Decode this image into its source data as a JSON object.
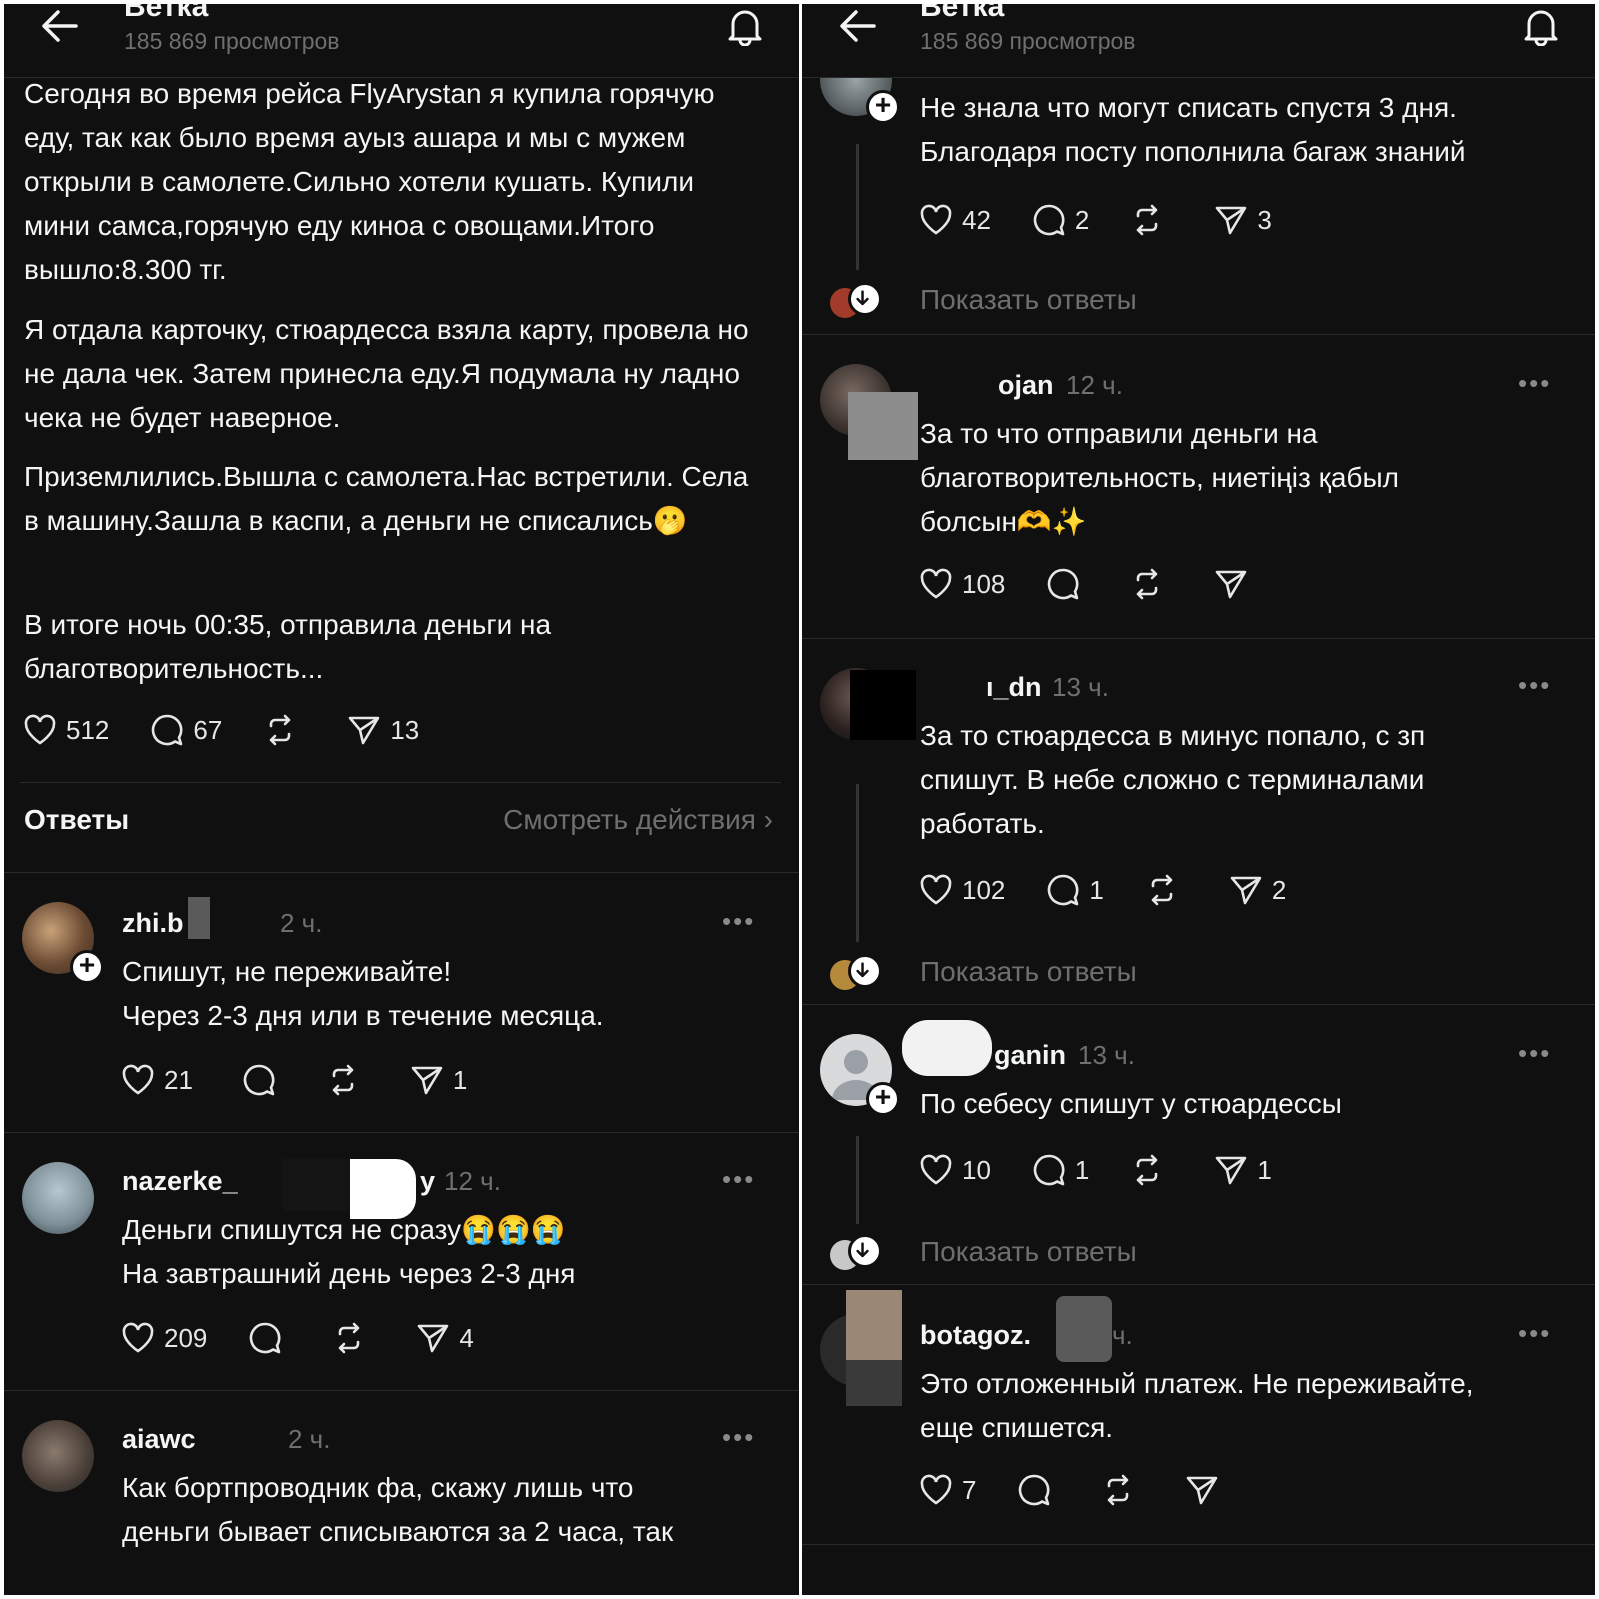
{
  "header": {
    "title": "Ветка",
    "views": "185 869 просмотров"
  },
  "post": {
    "paragraphs": [
      "Сегодня во время рейса FlyArystan я купила горячую еду, так как было время ауыз ашара и мы с мужем открыли в самолете.Сильно хотели кушать. Купили мини самса,горячую еду киноа с овощами.Итого вышло:8.300 тг.",
      "Я отдала карточку, стюардесса взяла карту, провела но не дала чек. Затем принесла еду.Я подумала ну ладно чека не будет наверное.",
      "Приземлились.Вышла с самолета.Нас встретили. Села в машину.Зашла в каспи, а деньги не списались🫢",
      "В итоге ночь 00:35, отправила деньги на благотворительность..."
    ],
    "likes": "512",
    "comments": "67",
    "shares": "13"
  },
  "replies_header": {
    "title": "Ответы",
    "link": "Смотреть действия ›"
  },
  "left_replies": [
    {
      "user": "zhi.b",
      "time": "2 ч.",
      "lines": [
        "Спишут, не переживайте!",
        "Через 2-3 дня или в течение месяца."
      ],
      "likes": "21",
      "comments": "",
      "shares": "1"
    },
    {
      "user": "nazerke_",
      "user_tail": "y",
      "time": "12 ч.",
      "lines": [
        "Деньги спишутся не сразу😭😭😭",
        "На завтрашний день через 2-3 дня"
      ],
      "likes": "209",
      "comments": "",
      "shares": "4"
    },
    {
      "user": "aiawc",
      "time": "2 ч.",
      "lines": [
        "Как бортпроводник фа, скажу лишь что",
        "деньги бывает списываются за 2 часа, так"
      ]
    }
  ],
  "right_top": {
    "lines": [
      "Не знала что могут списать спустя 3 дня.",
      "Благодаря посту пополнила багаж знаний"
    ],
    "likes": "42",
    "comments": "2",
    "shares": "3"
  },
  "show_replies_label": "Показать ответы",
  "right_replies": [
    {
      "user": "ojan",
      "time": "12 ч.",
      "lines": [
        "За то что отправили деньги на",
        "благотворительность, ниетіңіз қабыл",
        "болсын🫶✨"
      ],
      "likes": "108",
      "comments": "",
      "shares": ""
    },
    {
      "user": "ı_dn",
      "time": "13 ч.",
      "lines": [
        "За то стюардесса в минус попало, с зп",
        "спишут. В небе сложно с терминалами",
        "работать."
      ],
      "likes": "102",
      "comments": "1",
      "shares": "2"
    },
    {
      "user": "ganin",
      "time": "13 ч.",
      "lines": [
        "По себесу спишут  у стюардессы"
      ],
      "likes": "10",
      "comments": "1",
      "shares": "1"
    },
    {
      "user": "botagoz.",
      "time": "ч.",
      "lines": [
        "Это отложенный платеж. Не переживайте,",
        "еще спишется."
      ],
      "likes": "7",
      "comments": "",
      "shares": ""
    }
  ],
  "more_label": "•••",
  "colors": {
    "background": "#101010",
    "text": "#f3f5f7",
    "muted": "#6f6f6f",
    "divider": "#2a2a2a"
  },
  "icons": [
    "back-arrow-icon",
    "bell-icon",
    "heart-icon",
    "comment-icon",
    "repost-icon",
    "send-icon",
    "plus-icon",
    "arrow-down-icon",
    "more-icon"
  ]
}
